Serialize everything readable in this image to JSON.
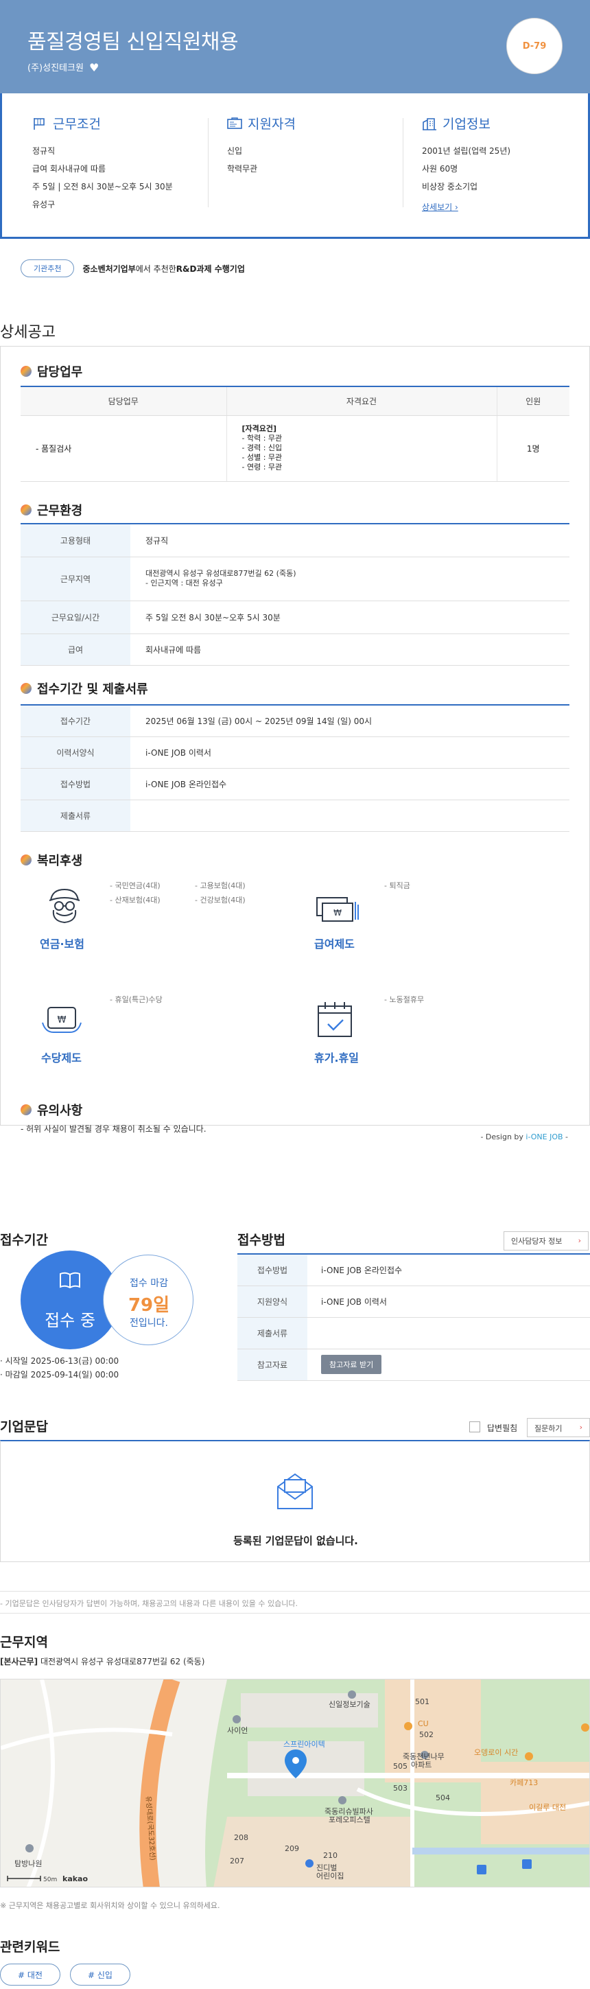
{
  "header": {
    "title": "품질경영팀 신입직원채용",
    "company": "(주)성진테크원",
    "dday": "D-79"
  },
  "summary": {
    "conditions": {
      "title": "근무조건",
      "lines": [
        "정규직",
        "급여 회사내규에 따름",
        "주 5일 | 오전 8시 30분~오후 5시 30분",
        "유성구"
      ]
    },
    "qualifications": {
      "title": "지원자격",
      "lines": [
        "신입",
        "학력무관"
      ]
    },
    "company_info": {
      "title": "기업정보",
      "lines": [
        "2001년 설립(업력 25년)",
        "사원 60명",
        "비상장 중소기업"
      ],
      "link": "상세보기 ›"
    }
  },
  "tagline": {
    "pill": "기관추천",
    "text_bold1": "중소벤처기업부",
    "text_mid": "에서 추천한 ",
    "text_bold2": "R&D과제 수행기업"
  },
  "detail": {
    "title": "상세공고",
    "duty": {
      "title": "담당업무",
      "headers": [
        "담당업무",
        "자격요건",
        "인원"
      ],
      "row": {
        "duty": "- 품질검사",
        "qual_title": "[자격요건]",
        "qual_lines": [
          "- 학력 : 무관",
          "- 경력 : 신입",
          "- 성별 : 무관",
          "- 연령 : 무관"
        ],
        "count": "1명"
      }
    },
    "environment": {
      "title": "근무환경",
      "rows": [
        {
          "label": "고용형태",
          "value": "정규직",
          "sub": ""
        },
        {
          "label": "근무지역",
          "value": "대전광역시 유성구 유성대로877번길 62 (죽동)",
          "sub": "- 인근지역 : 대전 유성구"
        },
        {
          "label": "근무요일/시간",
          "value": "주 5일 오전 8시 30분~오후 5시 30분",
          "sub": ""
        },
        {
          "label": "급여",
          "value": "회사내규에 따름",
          "sub": ""
        }
      ]
    },
    "documents": {
      "title": "접수기간 및 제출서류",
      "rows": [
        {
          "label": "접수기간",
          "value": "2025년 06월 13일 (금) 00시 ~ 2025년 09월 14일 (일) 00시"
        },
        {
          "label": "이력서양식",
          "value": "i-ONE JOB 이력서"
        },
        {
          "label": "접수방법",
          "value": "i-ONE JOB 온라인접수"
        },
        {
          "label": "제출서류",
          "value": ""
        }
      ]
    },
    "welfare": {
      "title": "복리후생",
      "items": [
        {
          "label": "연금·보험",
          "lines_a": [
            "- 국민연금(4대)",
            "- 산재보험(4대)"
          ],
          "lines_b": [
            "- 고용보험(4대)",
            "- 건강보험(4대)"
          ]
        },
        {
          "label": "급여제도",
          "lines_a": [
            "- 퇴직금"
          ],
          "lines_b": []
        },
        {
          "label": "수당제도",
          "lines_a": [
            "- 휴일(특근)수당"
          ],
          "lines_b": []
        },
        {
          "label": "휴가.휴일",
          "lines_a": [
            "- 노동절휴무"
          ],
          "lines_b": []
        }
      ]
    },
    "notice": {
      "title": "유의사항",
      "text": "- 허위 사실이 발견될 경우 채용이 취소될 수 있습니다."
    },
    "design_by_prefix": "- Design by ",
    "design_by_brand": "i-ONE JOB",
    "design_by_suffix": " -"
  },
  "period": {
    "title": "접수기간",
    "status": "접수 중",
    "deadline_label": "접수 마감",
    "deadline_days": "79일",
    "deadline_suffix": "전입니다.",
    "start": "· 시작일 2025-06-13(금) 00:00",
    "end": "· 마감일 2025-09-14(일) 00:00"
  },
  "apply": {
    "title": "접수방법",
    "hr_button": "인사담당자 정보",
    "rows": [
      {
        "label": "접수방법",
        "value": "i-ONE JOB 온라인접수"
      },
      {
        "label": "지원양식",
        "value": "i-ONE JOB 이력서"
      },
      {
        "label": "제출서류",
        "value": ""
      },
      {
        "label": "참고자료",
        "value": ""
      }
    ],
    "ref_button": "참고자료 받기"
  },
  "qa": {
    "title": "기업문답",
    "checkbox_label": "답변필침",
    "ask_button": "질문하기",
    "empty": "등록된 기업문답이 없습니다.",
    "note": "- 기업문답은 인사담당자가 답변이 가능하며, 채용공고의 내용과 다른 내용이 있을 수 있습니다."
  },
  "location": {
    "title": "근무지역",
    "addr_label": "[본사근무]",
    "addr": " 대전광역시 유성구 유성대로877번길 62 (죽동)",
    "map_labels": {
      "pin": "스프린아이텍",
      "siein": "사이언",
      "sinil": "신일정보기술",
      "jukdong1": "죽동천년나무\n아파트",
      "jukdong2": "죽동리슈빌파사\n포레오피스텔",
      "road": "유성대로(국도32호선)",
      "cu": "CU",
      "ramen": "오뎅로이 시간",
      "cafe": "카페713",
      "gym": "이길루 대전",
      "park": "탐방나원",
      "scale": "50m",
      "kakao": "kakao",
      "n501": "501",
      "n502": "502",
      "n503": "503",
      "n504": "504",
      "n505": "505",
      "n207": "207",
      "n208": "208",
      "n209": "209",
      "n210": "210",
      "kids": "진디벌\n어린이집"
    },
    "note": "※ 근무지역은 채용공고별로 회사위치와 상이할 수 있으니 유의하세요."
  },
  "keywords": {
    "title": "관련키워드",
    "items": [
      "# 대전",
      "# 신입"
    ]
  },
  "colors": {
    "hero_bg": "#6e96c4",
    "accent": "#2f6cc1",
    "dday": "#f0913f"
  }
}
